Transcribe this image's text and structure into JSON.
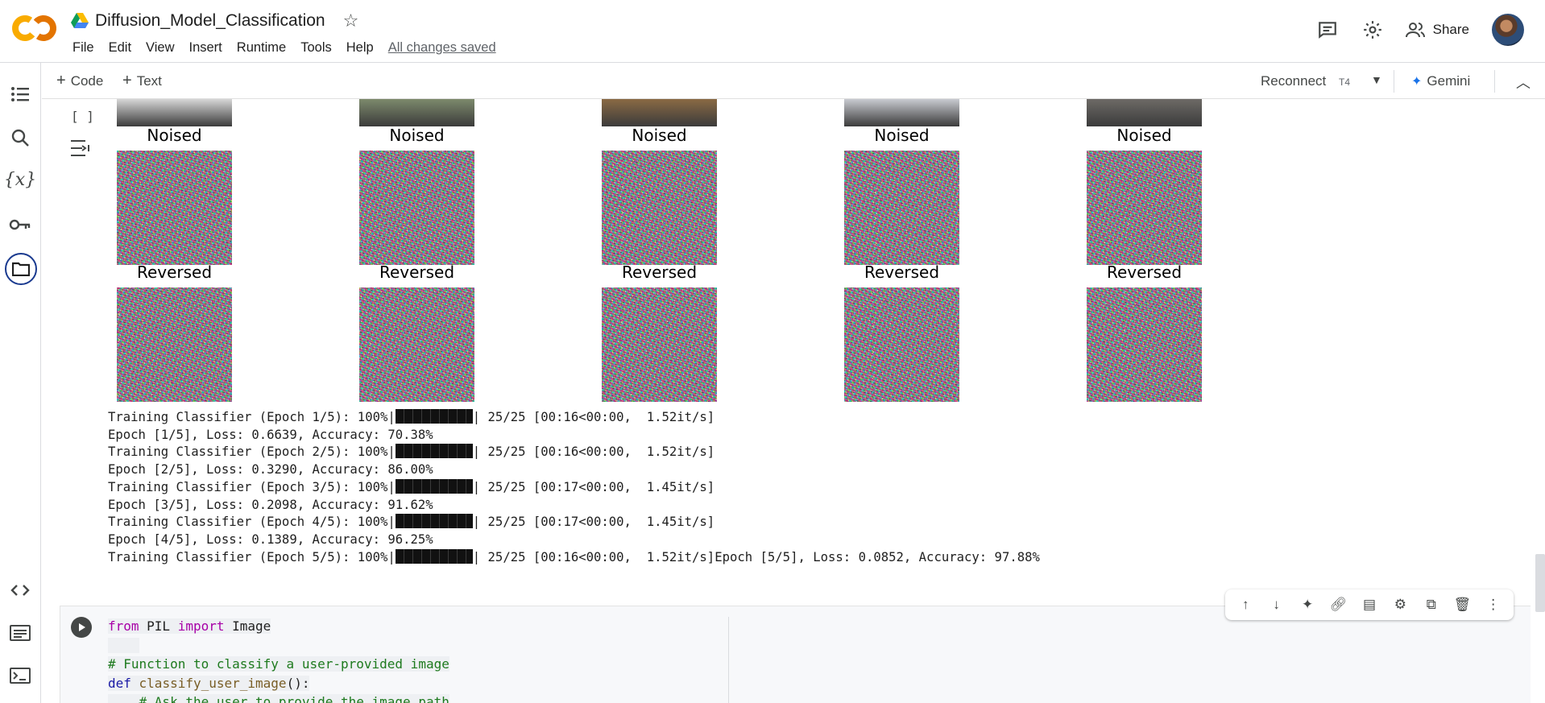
{
  "header": {
    "doc_title": "Diffusion_Model_Classification",
    "menu": [
      "File",
      "Edit",
      "View",
      "Insert",
      "Runtime",
      "Tools",
      "Help"
    ],
    "save_status": "All changes saved",
    "share_label": "Share"
  },
  "toolbar": {
    "add_code": "Code",
    "add_text": "Text",
    "reconnect": "Reconnect",
    "gpu": "T4",
    "gemini": "Gemini"
  },
  "output": {
    "brackets": "[ ]",
    "noised_label": "Noised",
    "reversed_label": "Reversed",
    "log": [
      {
        "prefix": "Training Classifier (Epoch 1/5): 100%|",
        "suffix": "| 25/25 [00:16<00:00,  1.52it/s]"
      },
      {
        "text": "Epoch [1/5], Loss: 0.6639, Accuracy: 70.38%"
      },
      {
        "prefix": "Training Classifier (Epoch 2/5): 100%|",
        "suffix": "| 25/25 [00:16<00:00,  1.52it/s]"
      },
      {
        "text": "Epoch [2/5], Loss: 0.3290, Accuracy: 86.00%"
      },
      {
        "prefix": "Training Classifier (Epoch 3/5): 100%|",
        "suffix": "| 25/25 [00:17<00:00,  1.45it/s]"
      },
      {
        "text": "Epoch [3/5], Loss: 0.2098, Accuracy: 91.62%"
      },
      {
        "prefix": "Training Classifier (Epoch 4/5): 100%|",
        "suffix": "| 25/25 [00:17<00:00,  1.45it/s]"
      },
      {
        "text": "Epoch [4/5], Loss: 0.1389, Accuracy: 96.25%"
      },
      {
        "prefix": "Training Classifier (Epoch 5/5): 100%|",
        "suffix": "| 25/25 [00:16<00:00,  1.52it/s]Epoch [5/5], Loss: 0.0852, Accuracy: 97.88%"
      }
    ]
  },
  "code": {
    "line1_from": "from",
    "line1_mod": " PIL ",
    "line1_import": "import",
    "line1_name": " Image",
    "line3": "# Function to classify a user-provided image",
    "line4_def": "def",
    "line4_fn": " classify_user_image",
    "line4_rest": "():",
    "line5": "    # Ask the user to provide the image path"
  },
  "colors": {
    "accent_blue": "#1a73e8",
    "logo_orange": "#f9ab00",
    "logo_dark_orange": "#e37400"
  }
}
